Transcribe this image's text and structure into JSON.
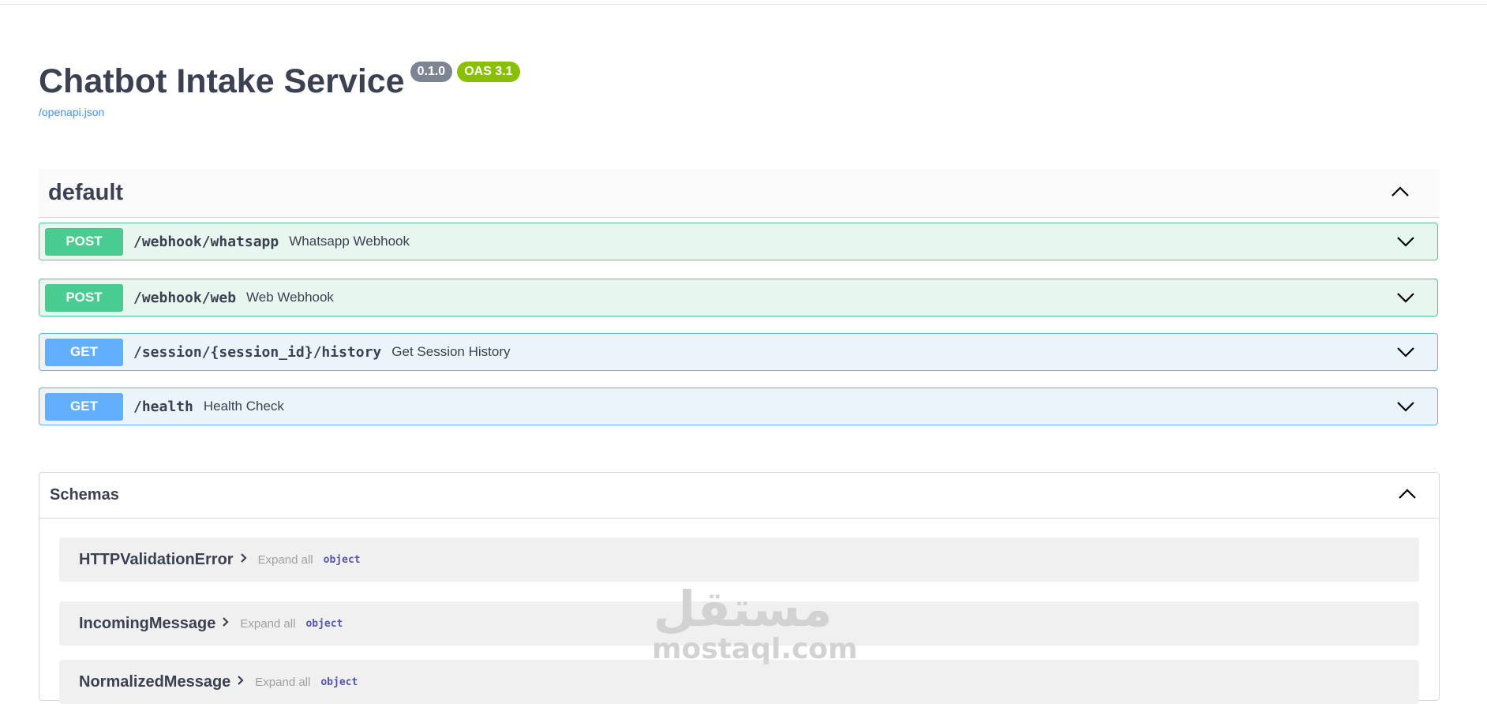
{
  "info": {
    "title": "Chatbot Intake Service",
    "version": "0.1.0",
    "oas": "OAS 3.1",
    "spec_link": "/openapi.json"
  },
  "tag": {
    "name": "default"
  },
  "operations": [
    {
      "method": "POST",
      "path": "/webhook/whatsapp",
      "summary": "Whatsapp Webhook"
    },
    {
      "method": "POST",
      "path": "/webhook/web",
      "summary": "Web Webhook"
    },
    {
      "method": "GET",
      "path": "/session/{session_id}/history",
      "summary": "Get Session History"
    },
    {
      "method": "GET",
      "path": "/health",
      "summary": "Health Check"
    }
  ],
  "schemas": {
    "title": "Schemas",
    "models": [
      {
        "name": "HTTPValidationError",
        "expand": "Expand all",
        "type": "object"
      },
      {
        "name": "IncomingMessage",
        "expand": "Expand all",
        "type": "object"
      },
      {
        "name": "NormalizedMessage",
        "expand": "Expand all",
        "type": "object"
      }
    ]
  },
  "watermark": {
    "arabic": "مستقل",
    "latin": "mostaql.com"
  },
  "colors": {
    "post": "#49cc90",
    "get": "#61affe",
    "version_badge": "#7d8492",
    "oas_badge": "#89bf04",
    "link": "#4990e2"
  }
}
